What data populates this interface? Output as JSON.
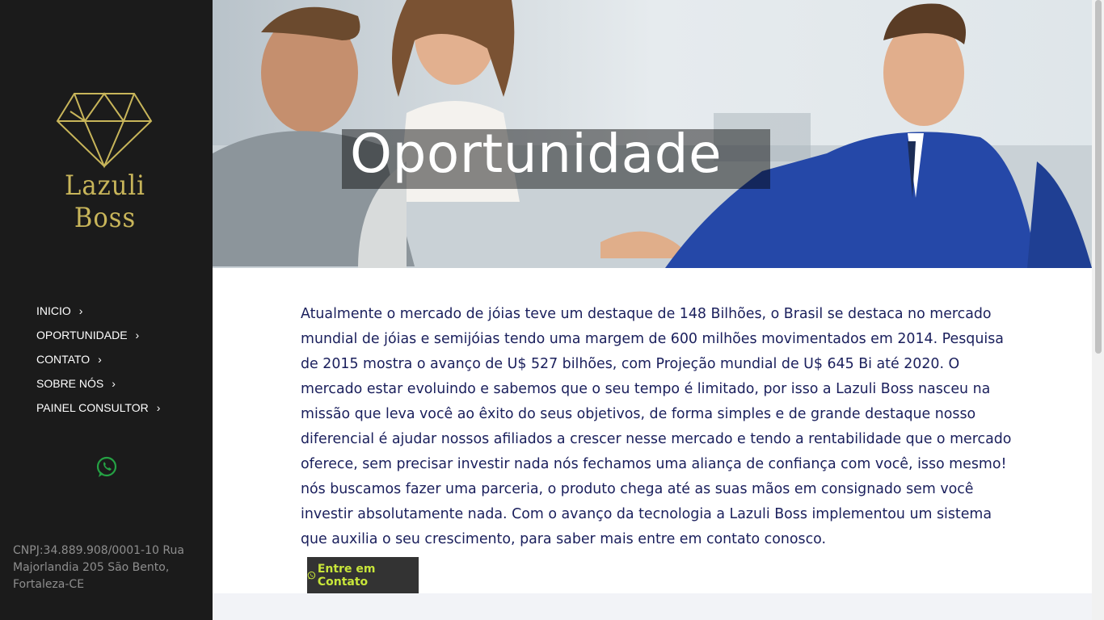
{
  "brand": {
    "name": "Lazuli Boss",
    "color": "#c8b55a"
  },
  "nav": {
    "items": [
      {
        "label": "INICIO"
      },
      {
        "label": "OPORTUNIDADE"
      },
      {
        "label": "CONTATO"
      },
      {
        "label": "SOBRE NÓS"
      },
      {
        "label": "PAINEL CONSULTOR"
      }
    ],
    "chevron": "›"
  },
  "sidebar": {
    "whatsapp_icon": "whatsapp-icon",
    "address": "CNPJ:34.889.908/0001-10 Rua Majorlandia 205 São Bento, Fortaleza-CE"
  },
  "hero": {
    "title": "Oportunidade"
  },
  "content": {
    "paragraph": "Atualmente o mercado de jóias teve um destaque de 148 Bilhões, o Brasil se destaca no mercado mundial de jóias e semijóias tendo uma margem de 600 milhões movimentados em 2014. Pesquisa de 2015 mostra o avanço de U$ 527 bilhões, com Projeção mundial de U$ 645 Bi até 2020. O mercado estar evoluindo e sabemos que o seu tempo é limitado, por isso a Lazuli Boss nasceu na missão que leva você ao êxito do seus objetivos, de forma simples e de grande destaque nosso diferencial é ajudar nossos afiliados a crescer nesse mercado e tendo a rentabilidade que o mercado oferece, sem precisar investir nada nós fechamos uma aliança de confiança com você, isso mesmo! nós buscamos fazer uma parceria, o produto chega até as suas mãos em consignado sem você investir absolutamente nada. Com o avanço da tecnologia a Lazuli Boss implementou um sistema que auxilia o seu crescimento, para saber mais entre em contato conosco.",
    "cta_label": "Entre em Contato"
  },
  "colors": {
    "sidebar_bg": "#1b1b1b",
    "text": "#1a1f5c",
    "cta_text": "#c8e63a",
    "whatsapp": "#25a244"
  }
}
